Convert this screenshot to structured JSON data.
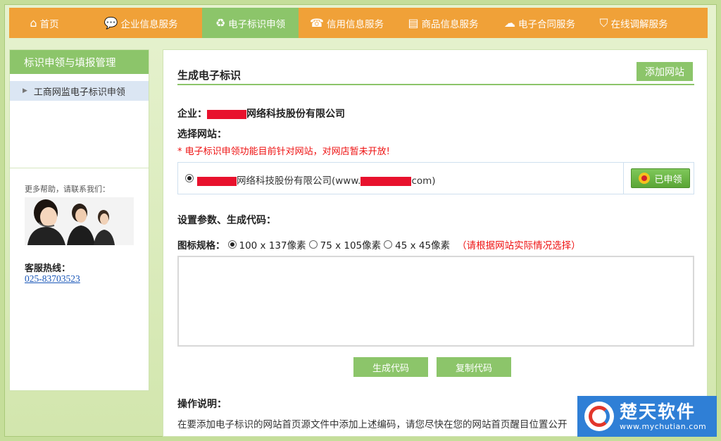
{
  "nav": {
    "items": [
      {
        "label": "首页",
        "icon": "home-icon",
        "glyph": "⌂",
        "width": 100
      },
      {
        "label": "企业信息服务",
        "icon": "chat-icon",
        "glyph": "💬",
        "width": 174
      },
      {
        "label": "电子标识申领",
        "icon": "recycle-icon",
        "glyph": "♻",
        "width": 137,
        "active": true
      },
      {
        "label": "信用信息服务",
        "icon": "phone-icon",
        "glyph": "☎",
        "width": 137
      },
      {
        "label": "商品信息服务",
        "icon": "document-icon",
        "glyph": "▤",
        "width": 137
      },
      {
        "label": "电子合同服务",
        "icon": "cloud-icon",
        "glyph": "☁",
        "width": 137
      },
      {
        "label": "在线调解服务",
        "icon": "shield-icon",
        "glyph": "⛉",
        "width": 130
      }
    ]
  },
  "sidebar": {
    "title": "标识申领与填报管理",
    "items": [
      {
        "label": "工商网监电子标识申领"
      }
    ],
    "help_title": "更多帮助，请联系我们：",
    "hotline_label": "客服热线：",
    "hotline_phone": "025-83703523"
  },
  "main": {
    "title": "生成电子标识",
    "add_site_button": "添加网站",
    "company_label": "企业：",
    "company_name_suffix": "网络科技股份有限公司",
    "choose_site_label": "选择网站：",
    "site_notice": "* 电子标识申领功能目前针对网站，对网店暂未开放!",
    "site": {
      "name_suffix": "网络科技股份有限公司(www.",
      "domain_suffix": "com)",
      "status_button": "已申领"
    },
    "params_label": "设置参数、生成代码：",
    "spec_label": "图标规格：",
    "spec_options": [
      "100 x 137像素",
      "75 x 105像素",
      "45 x 45像素"
    ],
    "spec_selected": 0,
    "spec_hint": "（请根据网站实际情况选择）",
    "generate_button": "生成代码",
    "copy_button": "复制代码",
    "instructions_title": "操作说明：",
    "instructions_text": "在要添加电子标识的网站首页源文件中添加上述编码，请您尽快在您的网站首页醒目位置公开"
  },
  "watermark": {
    "name": "楚天软件",
    "url": "www.mychutian.com"
  }
}
